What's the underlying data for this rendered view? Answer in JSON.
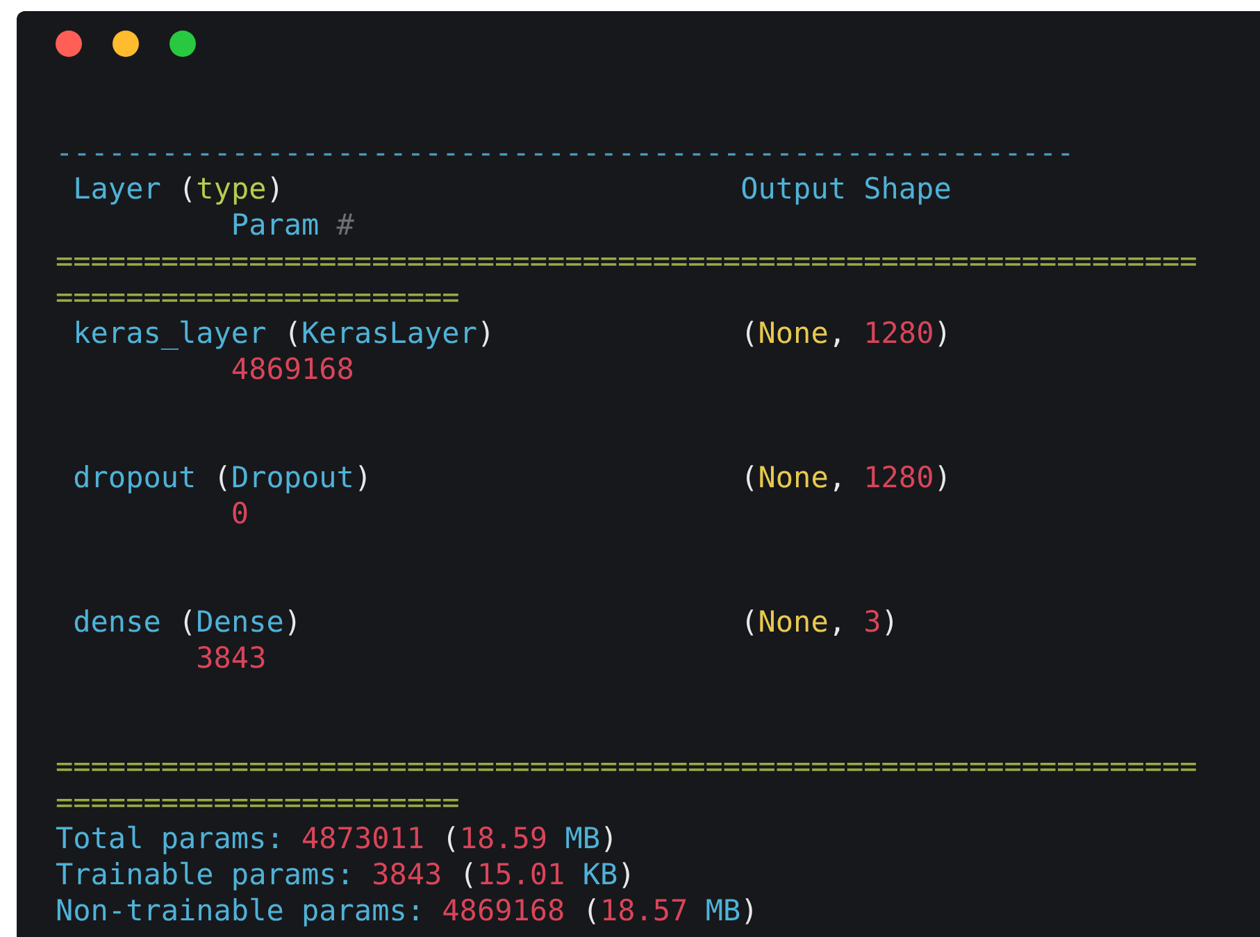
{
  "window": {
    "controls": [
      {
        "color": "#ff5f57"
      },
      {
        "color": "#febc2e"
      },
      {
        "color": "#28c840"
      }
    ]
  },
  "lines": [
    {
      "kind": "code",
      "tokens": [
        {
          "kind": "dash",
          "text": "----------------------------------------------------------"
        }
      ]
    },
    {
      "kind": "code",
      "tokens": [
        {
          "kind": "ident",
          "text": " Layer "
        },
        {
          "kind": "paren",
          "text": "("
        },
        {
          "kind": "keyword",
          "text": "type"
        },
        {
          "kind": "paren",
          "text": ")                          "
        },
        {
          "kind": "ident",
          "text": "Output Shape"
        }
      ]
    },
    {
      "kind": "code",
      "tokens": [
        {
          "kind": "ident",
          "text": "          Param "
        },
        {
          "kind": "comment",
          "text": "#"
        }
      ]
    },
    {
      "kind": "code",
      "tokens": [
        {
          "kind": "eq",
          "text": "================================================================="
        }
      ]
    },
    {
      "kind": "code",
      "tokens": [
        {
          "kind": "eq",
          "text": "======================="
        }
      ]
    },
    {
      "kind": "code",
      "tokens": [
        {
          "kind": "ident",
          "text": " keras_layer "
        },
        {
          "kind": "paren",
          "text": "("
        },
        {
          "kind": "ident",
          "text": "KerasLayer"
        },
        {
          "kind": "paren",
          "text": ")              ("
        },
        {
          "kind": "none",
          "text": "None"
        },
        {
          "kind": "paren",
          "text": ", "
        },
        {
          "kind": "number",
          "text": "1280"
        },
        {
          "kind": "paren",
          "text": ")"
        }
      ]
    },
    {
      "kind": "code",
      "tokens": [
        {
          "kind": "number",
          "text": "          4869168"
        }
      ]
    },
    {
      "kind": "blank"
    },
    {
      "kind": "blank"
    },
    {
      "kind": "code",
      "tokens": [
        {
          "kind": "ident",
          "text": " dropout "
        },
        {
          "kind": "paren",
          "text": "("
        },
        {
          "kind": "ident",
          "text": "Dropout"
        },
        {
          "kind": "paren",
          "text": ")                     ("
        },
        {
          "kind": "none",
          "text": "None"
        },
        {
          "kind": "paren",
          "text": ", "
        },
        {
          "kind": "number",
          "text": "1280"
        },
        {
          "kind": "paren",
          "text": ")"
        }
      ]
    },
    {
      "kind": "code",
      "tokens": [
        {
          "kind": "number",
          "text": "          0"
        }
      ]
    },
    {
      "kind": "blank"
    },
    {
      "kind": "blank"
    },
    {
      "kind": "code",
      "tokens": [
        {
          "kind": "ident",
          "text": " dense "
        },
        {
          "kind": "paren",
          "text": "("
        },
        {
          "kind": "ident",
          "text": "Dense"
        },
        {
          "kind": "paren",
          "text": ")                         ("
        },
        {
          "kind": "none",
          "text": "None"
        },
        {
          "kind": "paren",
          "text": ", "
        },
        {
          "kind": "number",
          "text": "3"
        },
        {
          "kind": "paren",
          "text": ")"
        }
      ]
    },
    {
      "kind": "code",
      "tokens": [
        {
          "kind": "number",
          "text": "        3843"
        }
      ]
    },
    {
      "kind": "blank"
    },
    {
      "kind": "blank"
    },
    {
      "kind": "code",
      "tokens": [
        {
          "kind": "eq",
          "text": "================================================================="
        }
      ]
    },
    {
      "kind": "code",
      "tokens": [
        {
          "kind": "eq",
          "text": "======================="
        }
      ]
    },
    {
      "kind": "code",
      "tokens": [
        {
          "kind": "ident",
          "text": "Total params: "
        },
        {
          "kind": "number",
          "text": "4873011 "
        },
        {
          "kind": "paren",
          "text": "("
        },
        {
          "kind": "number",
          "text": "18.59 "
        },
        {
          "kind": "ident",
          "text": "MB"
        },
        {
          "kind": "paren",
          "text": ")"
        }
      ]
    },
    {
      "kind": "code",
      "tokens": [
        {
          "kind": "ident",
          "text": "Trainable params: "
        },
        {
          "kind": "number",
          "text": "3843 "
        },
        {
          "kind": "paren",
          "text": "("
        },
        {
          "kind": "number",
          "text": "15.01 "
        },
        {
          "kind": "ident",
          "text": "KB"
        },
        {
          "kind": "paren",
          "text": ")"
        }
      ]
    },
    {
      "kind": "code",
      "tokens": [
        {
          "kind": "ident",
          "text": "Non-trainable params: "
        },
        {
          "kind": "number",
          "text": "4869168 "
        },
        {
          "kind": "paren",
          "text": "("
        },
        {
          "kind": "number",
          "text": "18.57 "
        },
        {
          "kind": "ident",
          "text": "MB"
        },
        {
          "kind": "paren",
          "text": ")"
        }
      ]
    }
  ]
}
